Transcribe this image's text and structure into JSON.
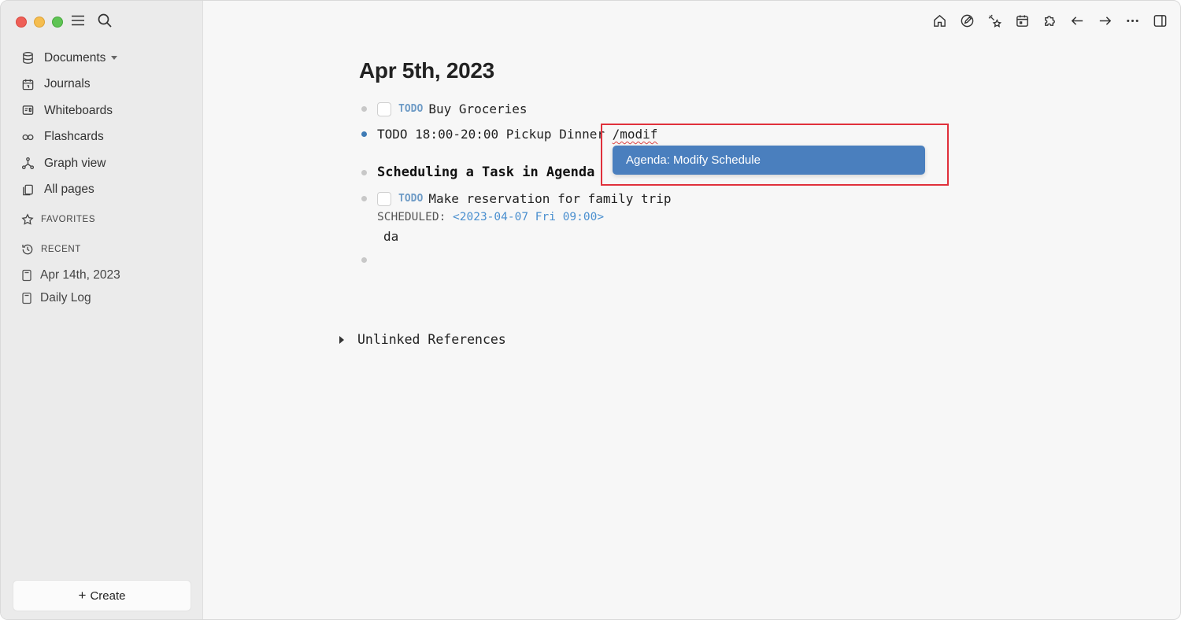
{
  "sidebar": {
    "nav": [
      {
        "label": "Documents",
        "icon": "database-icon",
        "has_dropdown": true
      },
      {
        "label": "Journals",
        "icon": "calendar-icon"
      },
      {
        "label": "Whiteboards",
        "icon": "whiteboard-icon"
      },
      {
        "label": "Flashcards",
        "icon": "infinity-icon"
      },
      {
        "label": "Graph view",
        "icon": "graph-icon"
      },
      {
        "label": "All pages",
        "icon": "pages-icon"
      }
    ],
    "favorites_label": "FAVORITES",
    "recent_label": "RECENT",
    "recent": [
      "Apr 14th, 2023",
      "Daily Log"
    ],
    "create_label": "Create"
  },
  "toolbar": {
    "icons": [
      "home-icon",
      "pencil-icon",
      "sparkle-icon",
      "calendar-icon",
      "puzzle-icon",
      "arrow-left-icon",
      "arrow-right-icon",
      "more-icon",
      "sidebar-toggle-icon"
    ]
  },
  "page": {
    "title": "Apr 5th, 2023",
    "blocks": {
      "b1": {
        "tag": "TODO",
        "text": "Buy Groceries"
      },
      "b2": {
        "text": "TODO 18:00-20:00 Pickup Dinner ",
        "command": "/modif"
      },
      "b3": {
        "text": "Scheduling a Task in Agenda"
      },
      "b4": {
        "tag": "TODO",
        "text": "Make reservation for family trip"
      },
      "scheduled_label": "SCHEDULED: ",
      "scheduled_date": "<2023-04-07 Fri 09:00>",
      "child_text": "da"
    },
    "popup": {
      "item": "Agenda: Modify Schedule"
    },
    "unlinked_references": "Unlinked References"
  }
}
